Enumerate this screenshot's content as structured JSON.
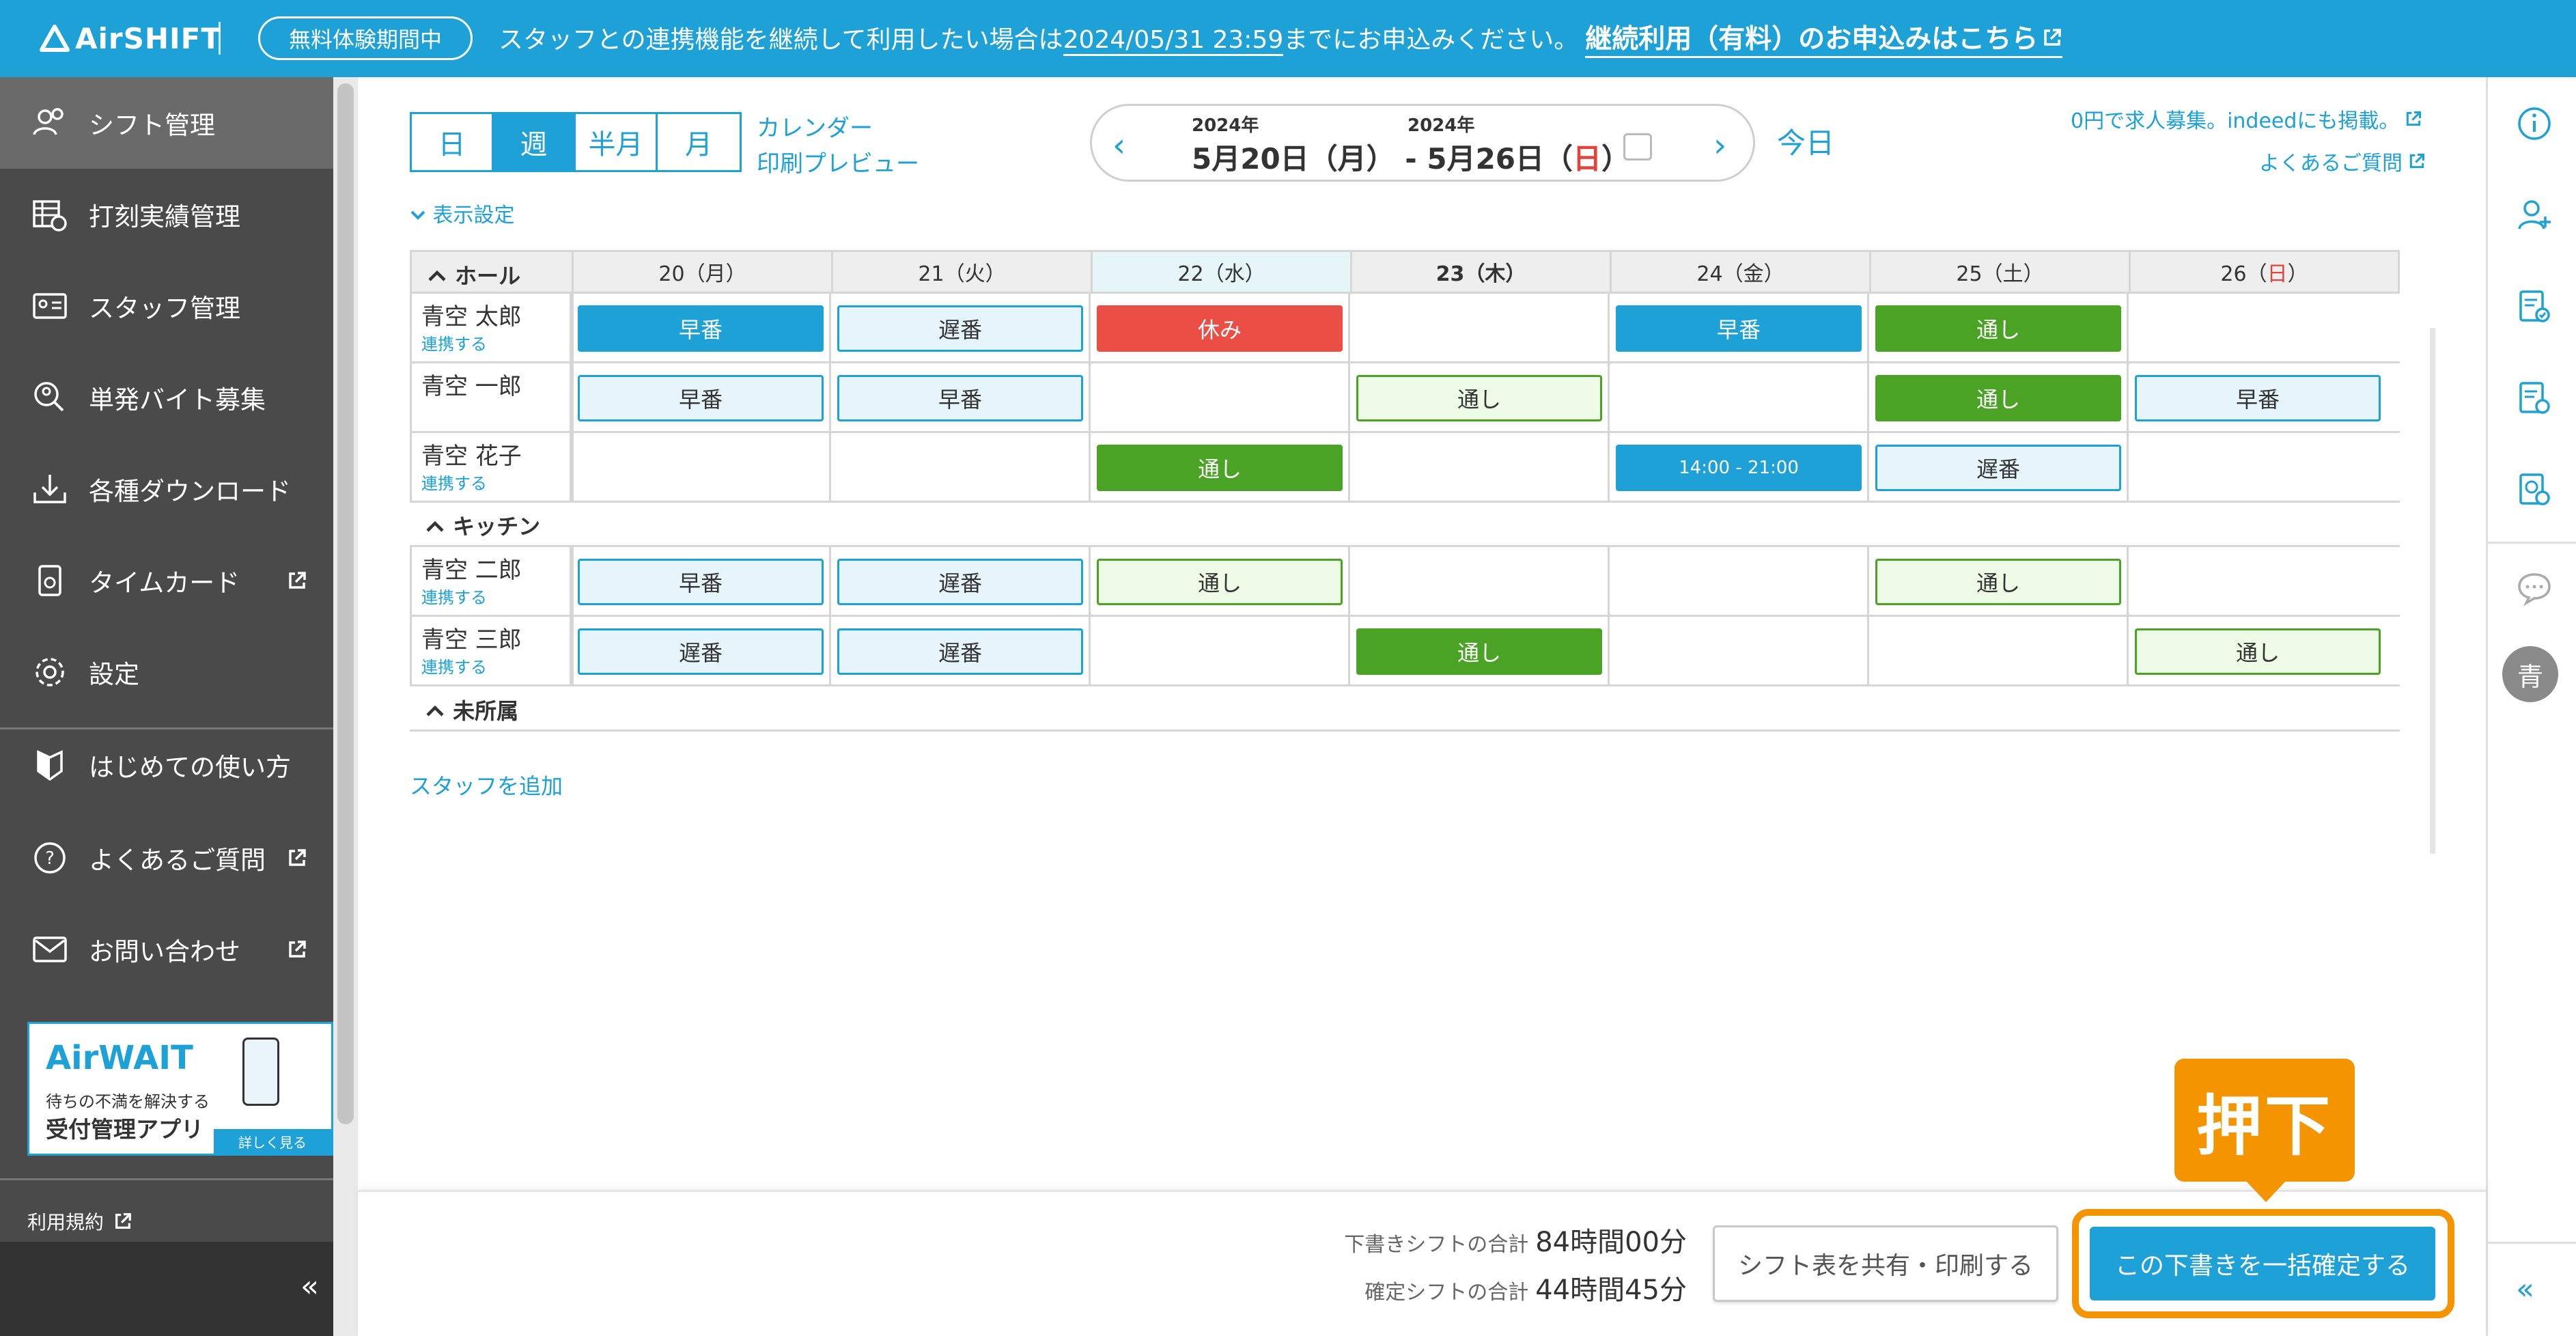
{
  "banner": {
    "logo": "AirSHIFT",
    "trial_badge": "無料体験期間中",
    "text_before": "スタッフとの連携機能を継続して利用したい場合は",
    "deadline": "2024/05/31 23:59",
    "text_after": "までにお申込みください。",
    "cta": "継続利用（有料）のお申込みはこちら"
  },
  "sidebar": {
    "items": [
      {
        "label": "シフト管理"
      },
      {
        "label": "打刻実績管理"
      },
      {
        "label": "スタッフ管理"
      },
      {
        "label": "単発バイト募集"
      },
      {
        "label": "各種ダウンロード"
      },
      {
        "label": "タイムカード"
      },
      {
        "label": "設定"
      },
      {
        "label": "はじめての使い方"
      },
      {
        "label": "よくあるご質問"
      },
      {
        "label": "お問い合わせ"
      }
    ],
    "promo": {
      "title": "AirWAIT",
      "sub1": "待ちの不満を解決する",
      "sub2": "受付管理アプリ",
      "button": "詳しく見る"
    },
    "terms": "利用規約",
    "collapse": "«"
  },
  "toolbar": {
    "view_tabs": [
      "日",
      "週",
      "半月",
      "月"
    ],
    "calendar_link": "カレンダー",
    "print_link": "印刷プレビュー",
    "prev": "‹",
    "next": "›",
    "year_start": "2024年",
    "year_end": "2024年",
    "date_start": "5月20日（月）",
    "date_sep": "-",
    "date_end_pre": "5月26日（",
    "date_end_sun": "日",
    "date_end_post": "）",
    "today": "今日",
    "recruit_link": "0円で求人募集。indeedにも掲載。",
    "faq_link": "よくあるご質問",
    "display_settings": "表示設定"
  },
  "grid": {
    "days": [
      "20（月）",
      "21（火）",
      "22（水）",
      "23（木）",
      "24（金）",
      "25（土）",
      "26（日）"
    ],
    "groups": [
      {
        "name": "ホール"
      },
      {
        "name": "キッチン"
      },
      {
        "name": "未所属"
      }
    ],
    "link_label": "連携する",
    "staff": [
      {
        "name": "青空 太郎",
        "linked": true,
        "shifts": [
          "早番",
          "遅番",
          "休み",
          "",
          "早番",
          "通し",
          ""
        ]
      },
      {
        "name": "青空 一郎",
        "linked": false,
        "shifts": [
          "早番",
          "早番",
          "",
          "通し",
          "",
          "通し",
          "早番"
        ]
      },
      {
        "name": "青空 花子",
        "linked": true,
        "shifts": [
          "",
          "",
          "通し",
          "",
          "14:00 - 21:00",
          "遅番",
          ""
        ]
      },
      {
        "name": "青空 二郎",
        "linked": true,
        "shifts": [
          "早番",
          "遅番",
          "通し",
          "",
          "",
          "通し",
          ""
        ]
      },
      {
        "name": "青空 三郎",
        "linked": true,
        "shifts": [
          "遅番",
          "遅番",
          "",
          "通し",
          "",
          "",
          "通し"
        ]
      }
    ],
    "add_staff": "スタッフを追加"
  },
  "footer": {
    "draft_label": "下書きシフトの合計",
    "draft_value": "84時間00分",
    "confirmed_label": "確定シフトの合計",
    "confirmed_value": "44時間45分",
    "share_button": "シフト表を共有・印刷する",
    "confirm_button": "この下書きを一括確定する",
    "callout": "押下"
  },
  "rail": {
    "avatar": "青",
    "collapse": "«"
  },
  "colors": {
    "brand": "#1da1d6",
    "green": "#4aa325",
    "red": "#ea4e45",
    "callout": "#f39400",
    "sidebar": "#4a4a4a"
  }
}
